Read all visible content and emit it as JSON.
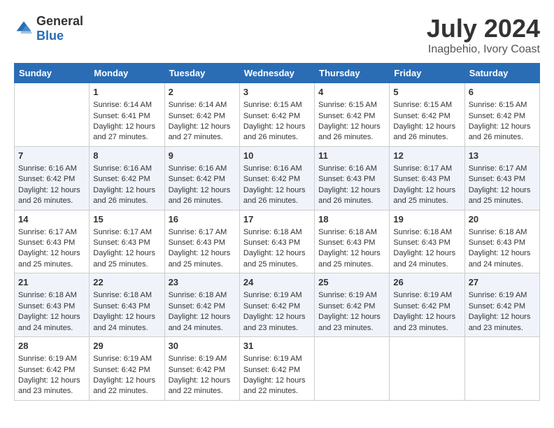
{
  "logo": {
    "general": "General",
    "blue": "Blue"
  },
  "title": "July 2024",
  "location": "Inagbehio, Ivory Coast",
  "days_header": [
    "Sunday",
    "Monday",
    "Tuesday",
    "Wednesday",
    "Thursday",
    "Friday",
    "Saturday"
  ],
  "weeks": [
    [
      {
        "num": "",
        "sunrise": "",
        "sunset": "",
        "daylight": "",
        "empty": true
      },
      {
        "num": "1",
        "sunrise": "Sunrise: 6:14 AM",
        "sunset": "Sunset: 6:41 PM",
        "daylight": "Daylight: 12 hours and 27 minutes."
      },
      {
        "num": "2",
        "sunrise": "Sunrise: 6:14 AM",
        "sunset": "Sunset: 6:42 PM",
        "daylight": "Daylight: 12 hours and 27 minutes."
      },
      {
        "num": "3",
        "sunrise": "Sunrise: 6:15 AM",
        "sunset": "Sunset: 6:42 PM",
        "daylight": "Daylight: 12 hours and 26 minutes."
      },
      {
        "num": "4",
        "sunrise": "Sunrise: 6:15 AM",
        "sunset": "Sunset: 6:42 PM",
        "daylight": "Daylight: 12 hours and 26 minutes."
      },
      {
        "num": "5",
        "sunrise": "Sunrise: 6:15 AM",
        "sunset": "Sunset: 6:42 PM",
        "daylight": "Daylight: 12 hours and 26 minutes."
      },
      {
        "num": "6",
        "sunrise": "Sunrise: 6:15 AM",
        "sunset": "Sunset: 6:42 PM",
        "daylight": "Daylight: 12 hours and 26 minutes."
      }
    ],
    [
      {
        "num": "7",
        "sunrise": "Sunrise: 6:16 AM",
        "sunset": "Sunset: 6:42 PM",
        "daylight": "Daylight: 12 hours and 26 minutes."
      },
      {
        "num": "8",
        "sunrise": "Sunrise: 6:16 AM",
        "sunset": "Sunset: 6:42 PM",
        "daylight": "Daylight: 12 hours and 26 minutes."
      },
      {
        "num": "9",
        "sunrise": "Sunrise: 6:16 AM",
        "sunset": "Sunset: 6:42 PM",
        "daylight": "Daylight: 12 hours and 26 minutes."
      },
      {
        "num": "10",
        "sunrise": "Sunrise: 6:16 AM",
        "sunset": "Sunset: 6:42 PM",
        "daylight": "Daylight: 12 hours and 26 minutes."
      },
      {
        "num": "11",
        "sunrise": "Sunrise: 6:16 AM",
        "sunset": "Sunset: 6:43 PM",
        "daylight": "Daylight: 12 hours and 26 minutes."
      },
      {
        "num": "12",
        "sunrise": "Sunrise: 6:17 AM",
        "sunset": "Sunset: 6:43 PM",
        "daylight": "Daylight: 12 hours and 25 minutes."
      },
      {
        "num": "13",
        "sunrise": "Sunrise: 6:17 AM",
        "sunset": "Sunset: 6:43 PM",
        "daylight": "Daylight: 12 hours and 25 minutes."
      }
    ],
    [
      {
        "num": "14",
        "sunrise": "Sunrise: 6:17 AM",
        "sunset": "Sunset: 6:43 PM",
        "daylight": "Daylight: 12 hours and 25 minutes."
      },
      {
        "num": "15",
        "sunrise": "Sunrise: 6:17 AM",
        "sunset": "Sunset: 6:43 PM",
        "daylight": "Daylight: 12 hours and 25 minutes."
      },
      {
        "num": "16",
        "sunrise": "Sunrise: 6:17 AM",
        "sunset": "Sunset: 6:43 PM",
        "daylight": "Daylight: 12 hours and 25 minutes."
      },
      {
        "num": "17",
        "sunrise": "Sunrise: 6:18 AM",
        "sunset": "Sunset: 6:43 PM",
        "daylight": "Daylight: 12 hours and 25 minutes."
      },
      {
        "num": "18",
        "sunrise": "Sunrise: 6:18 AM",
        "sunset": "Sunset: 6:43 PM",
        "daylight": "Daylight: 12 hours and 25 minutes."
      },
      {
        "num": "19",
        "sunrise": "Sunrise: 6:18 AM",
        "sunset": "Sunset: 6:43 PM",
        "daylight": "Daylight: 12 hours and 24 minutes."
      },
      {
        "num": "20",
        "sunrise": "Sunrise: 6:18 AM",
        "sunset": "Sunset: 6:43 PM",
        "daylight": "Daylight: 12 hours and 24 minutes."
      }
    ],
    [
      {
        "num": "21",
        "sunrise": "Sunrise: 6:18 AM",
        "sunset": "Sunset: 6:43 PM",
        "daylight": "Daylight: 12 hours and 24 minutes."
      },
      {
        "num": "22",
        "sunrise": "Sunrise: 6:18 AM",
        "sunset": "Sunset: 6:43 PM",
        "daylight": "Daylight: 12 hours and 24 minutes."
      },
      {
        "num": "23",
        "sunrise": "Sunrise: 6:18 AM",
        "sunset": "Sunset: 6:42 PM",
        "daylight": "Daylight: 12 hours and 24 minutes."
      },
      {
        "num": "24",
        "sunrise": "Sunrise: 6:19 AM",
        "sunset": "Sunset: 6:42 PM",
        "daylight": "Daylight: 12 hours and 23 minutes."
      },
      {
        "num": "25",
        "sunrise": "Sunrise: 6:19 AM",
        "sunset": "Sunset: 6:42 PM",
        "daylight": "Daylight: 12 hours and 23 minutes."
      },
      {
        "num": "26",
        "sunrise": "Sunrise: 6:19 AM",
        "sunset": "Sunset: 6:42 PM",
        "daylight": "Daylight: 12 hours and 23 minutes."
      },
      {
        "num": "27",
        "sunrise": "Sunrise: 6:19 AM",
        "sunset": "Sunset: 6:42 PM",
        "daylight": "Daylight: 12 hours and 23 minutes."
      }
    ],
    [
      {
        "num": "28",
        "sunrise": "Sunrise: 6:19 AM",
        "sunset": "Sunset: 6:42 PM",
        "daylight": "Daylight: 12 hours and 23 minutes."
      },
      {
        "num": "29",
        "sunrise": "Sunrise: 6:19 AM",
        "sunset": "Sunset: 6:42 PM",
        "daylight": "Daylight: 12 hours and 22 minutes."
      },
      {
        "num": "30",
        "sunrise": "Sunrise: 6:19 AM",
        "sunset": "Sunset: 6:42 PM",
        "daylight": "Daylight: 12 hours and 22 minutes."
      },
      {
        "num": "31",
        "sunrise": "Sunrise: 6:19 AM",
        "sunset": "Sunset: 6:42 PM",
        "daylight": "Daylight: 12 hours and 22 minutes."
      },
      {
        "num": "",
        "sunrise": "",
        "sunset": "",
        "daylight": "",
        "empty": true
      },
      {
        "num": "",
        "sunrise": "",
        "sunset": "",
        "daylight": "",
        "empty": true
      },
      {
        "num": "",
        "sunrise": "",
        "sunset": "",
        "daylight": "",
        "empty": true
      }
    ]
  ]
}
